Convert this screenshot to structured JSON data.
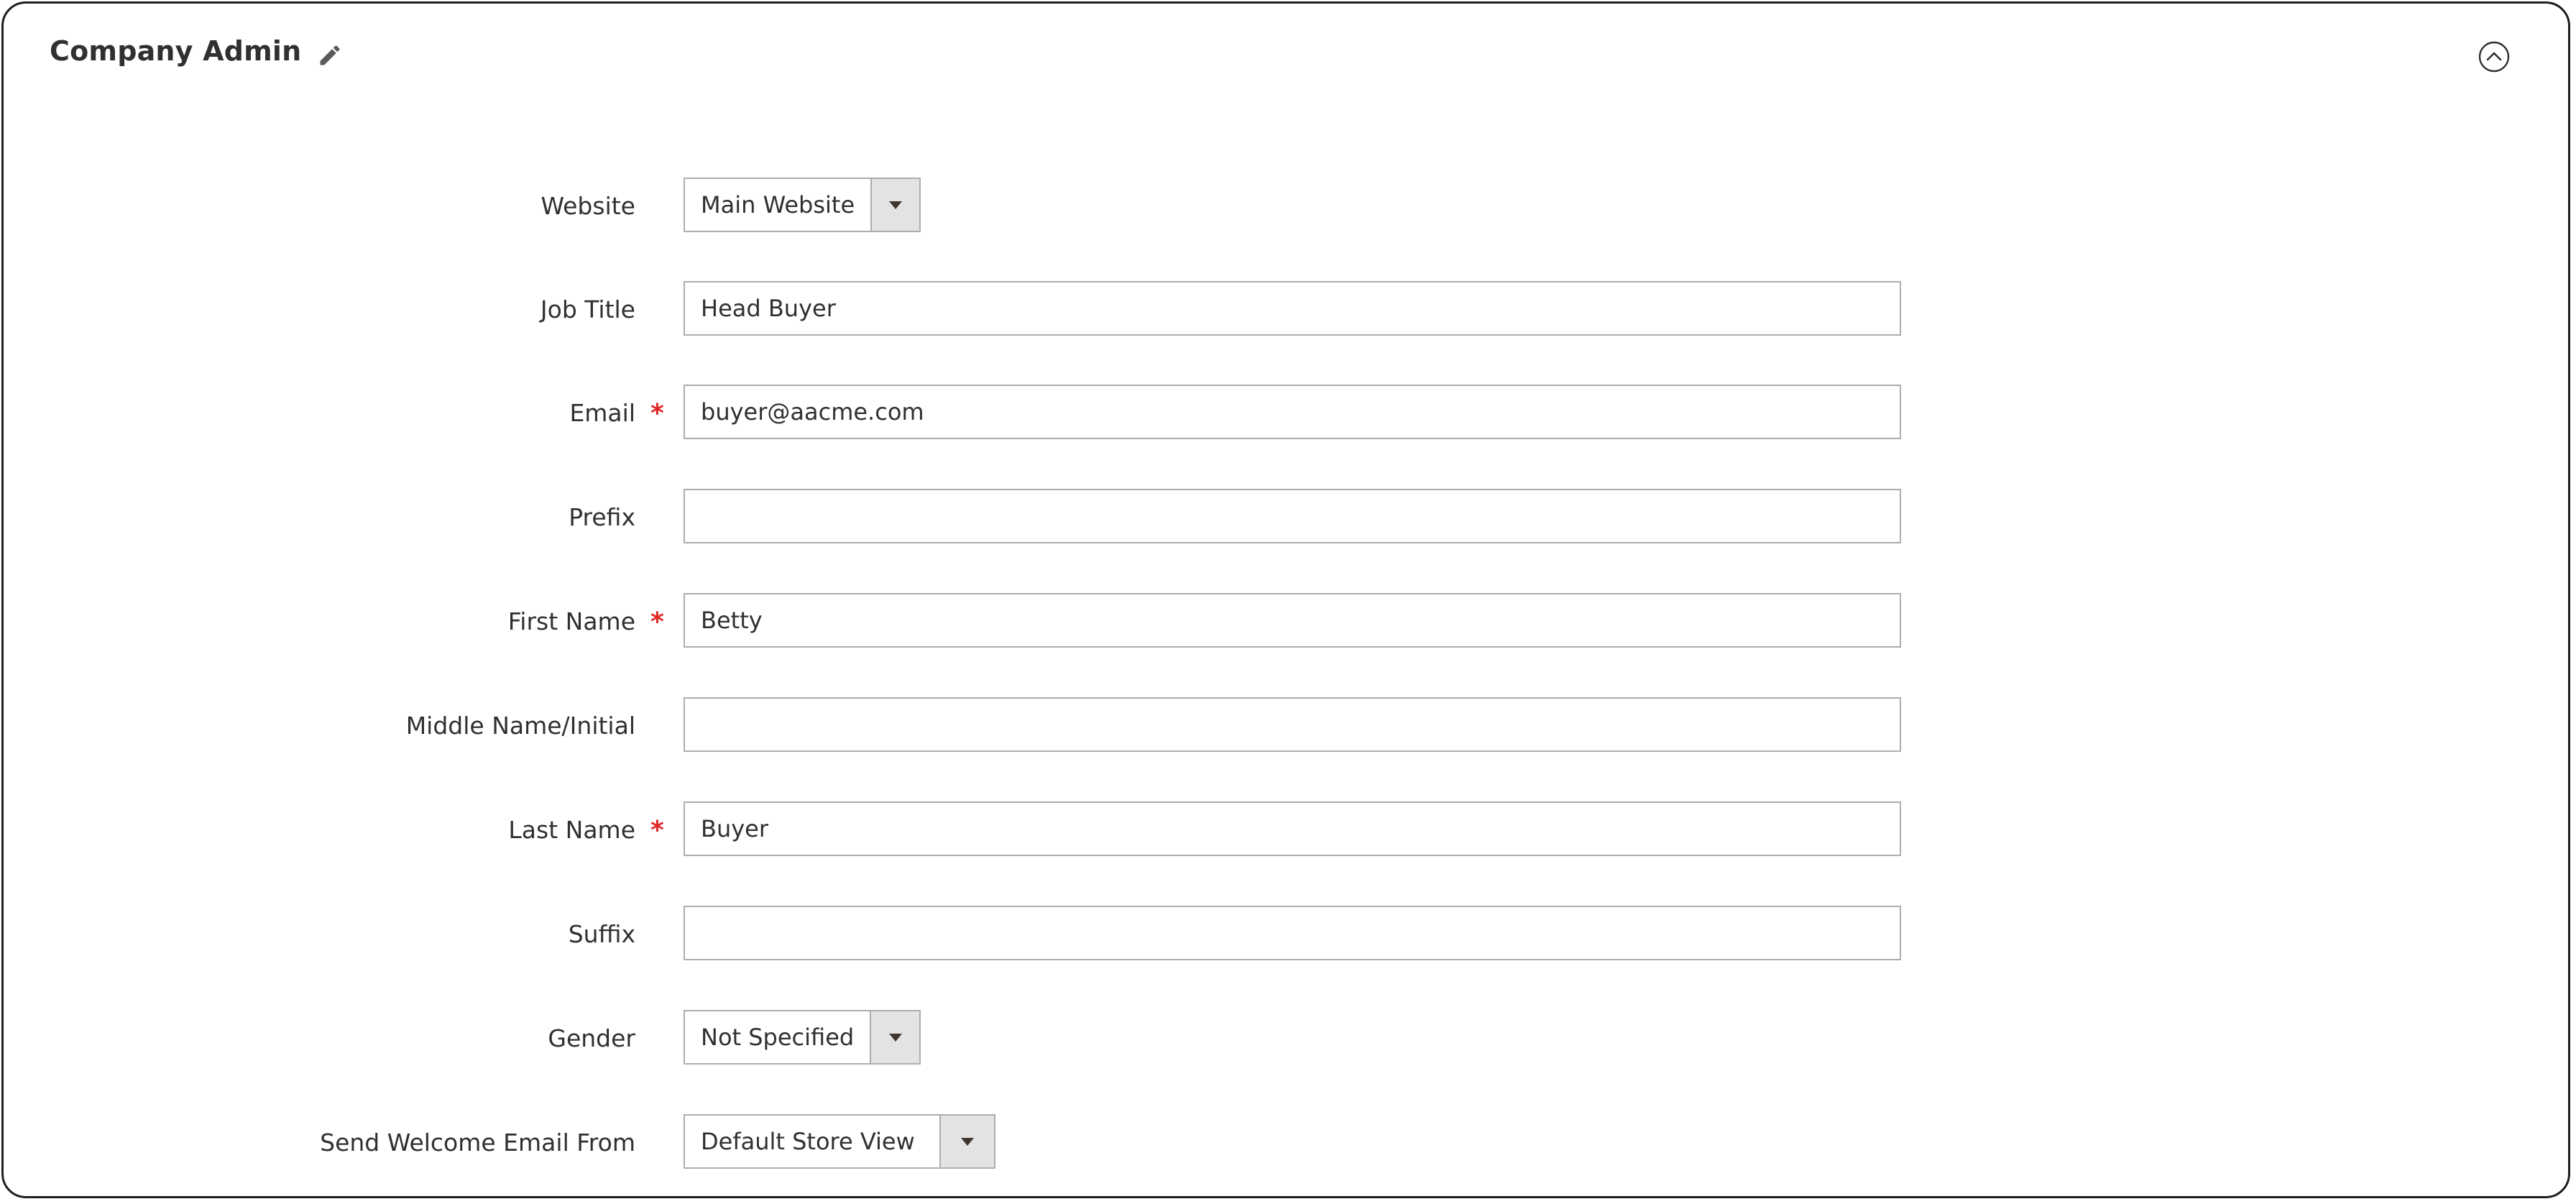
{
  "section": {
    "title": "Company Admin"
  },
  "icons": {
    "edit": "pencil-icon",
    "collapse": "chevron-up-circle-icon"
  },
  "colors": {
    "required": "#e22626",
    "border": "#adadad",
    "select_button": "#e3e3e3"
  },
  "fields": {
    "website": {
      "label": "Website",
      "value": "Main Website"
    },
    "job_title": {
      "label": "Job Title",
      "value": "Head Buyer"
    },
    "email": {
      "label": "Email",
      "value": "buyer@aacme.com",
      "required_mark": "*"
    },
    "prefix": {
      "label": "Prefix",
      "value": ""
    },
    "first_name": {
      "label": "First Name",
      "value": "Betty",
      "required_mark": "*"
    },
    "middle_name": {
      "label": "Middle Name/Initial",
      "value": ""
    },
    "last_name": {
      "label": "Last Name",
      "value": "Buyer",
      "required_mark": "*"
    },
    "suffix": {
      "label": "Suffix",
      "value": ""
    },
    "gender": {
      "label": "Gender",
      "value": "Not Specified"
    },
    "send_welcome_email_from": {
      "label": "Send Welcome Email From",
      "value": "Default Store View"
    }
  }
}
